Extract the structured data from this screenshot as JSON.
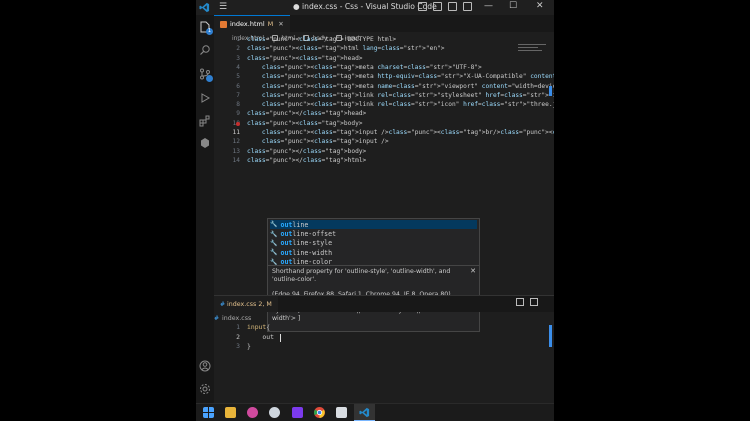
{
  "window": {
    "title": "● index.css - Css - Visual Studio Code",
    "controls": {
      "minimize": "—",
      "maximize": "☐",
      "close": "✕"
    }
  },
  "activity_bar": {
    "items": [
      {
        "icon": "files-icon",
        "badge": "1"
      },
      {
        "icon": "search-icon"
      },
      {
        "icon": "source-control-icon"
      },
      {
        "icon": "run-debug-icon"
      },
      {
        "icon": "extensions-icon"
      },
      {
        "icon": "node-icon"
      }
    ],
    "bottom": [
      {
        "icon": "account-icon"
      },
      {
        "icon": "gear-icon"
      }
    ]
  },
  "top_editor": {
    "tab": {
      "label": "index.html",
      "modified": "M",
      "close": "✕"
    },
    "breadcrumb": [
      "index.html",
      "html",
      "body",
      "input"
    ],
    "lines": [
      {
        "n": "1",
        "text": "<!DOCTYPE html>"
      },
      {
        "n": "2",
        "text": "<html lang=\"en\">"
      },
      {
        "n": "3",
        "text": "<head>"
      },
      {
        "n": "4",
        "text": "    <meta charset=\"UTF-8\">"
      },
      {
        "n": "5",
        "text": "    <meta http-equiv=\"X-UA-Compatible\" content=\"IE=edge\">"
      },
      {
        "n": "6",
        "text": "    <meta name=\"viewport\" content=\"width=device-width, initial-scale=1."
      },
      {
        "n": "7",
        "text": "    <link rel=\"stylesheet\" href=\"index.css\">"
      },
      {
        "n": "8",
        "text": "    <link rel=\"icon\" href=\"three.jpg\" >"
      },
      {
        "n": "9",
        "text": "</head>"
      },
      {
        "n": "10",
        "text": "<body>"
      },
      {
        "n": "11",
        "text": "    <input /><br/><br/>"
      },
      {
        "n": "12",
        "text": "    <input />"
      },
      {
        "n": "13",
        "text": "</body>"
      },
      {
        "n": "14",
        "text": "</html>"
      }
    ]
  },
  "suggestions": {
    "items": [
      {
        "match": "out",
        "rest": "line"
      },
      {
        "match": "out",
        "rest": "line-offset"
      },
      {
        "match": "out",
        "rest": "line-style"
      },
      {
        "match": "out",
        "rest": "line-width"
      },
      {
        "match": "out",
        "rest": "line-color"
      }
    ],
    "detail": {
      "description": "Shorthand property for 'outline-style', 'outline-width', and 'outline-color'.",
      "compat": "(Edge 94, Firefox 88, Safari 1, Chrome 94, IE 8, Opera 80)",
      "syntax": "Syntax: [ <'outline-color'> || <'outline-style'> || <'outline-width'> ]",
      "close": "✕"
    }
  },
  "bottom_editor": {
    "tab": {
      "label": "index.css",
      "modified": "2, M"
    },
    "breadcrumb": "index.css",
    "lines": [
      {
        "n": "1",
        "text": "input{"
      },
      {
        "n": "2",
        "text": "    out"
      },
      {
        "n": "3",
        "text": "}"
      }
    ]
  },
  "taskbar": {
    "items": [
      "windows-start-icon",
      "file-explorer-icon",
      "app-icon",
      "cloud-icon",
      "media-icon",
      "chrome-icon",
      "notepad-icon",
      "vscode-icon"
    ]
  },
  "colors": {
    "accent": "#0078d4",
    "tag": "#569cd6",
    "attr": "#9cdcfe",
    "string": "#ce9178",
    "match": "#2aaaff"
  }
}
